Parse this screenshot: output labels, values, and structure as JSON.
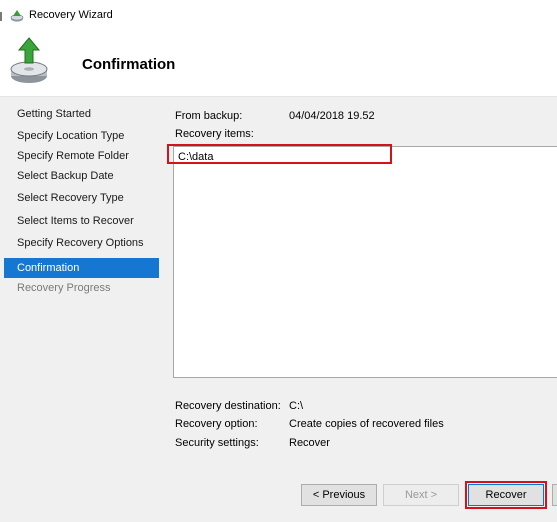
{
  "window": {
    "title": "Recovery Wizard",
    "icon": "wizard-app-icon"
  },
  "header": {
    "title": "Confirmation",
    "icon": "backup-disk-icon"
  },
  "sidebar": {
    "steps": [
      {
        "label": "Getting Started",
        "state": "done"
      },
      {
        "label": "Specify Location Type",
        "state": "done"
      },
      {
        "label": "Specify Remote Folder",
        "state": "done"
      },
      {
        "label": "Select Backup Date",
        "state": "done"
      },
      {
        "label": "Select Recovery Type",
        "state": "done"
      },
      {
        "label": "Select Items to Recover",
        "state": "done"
      },
      {
        "label": "Specify Recovery Options",
        "state": "done"
      },
      {
        "label": "Confirmation",
        "state": "active"
      },
      {
        "label": "Recovery Progress",
        "state": "disabled"
      }
    ]
  },
  "summary": {
    "from_backup_label": "From backup:",
    "from_backup_value": "04/04/2018 19.52",
    "recovery_items_label": "Recovery items:",
    "items": [
      "C:\\data"
    ],
    "destination_label": "Recovery destination:",
    "destination_value": "C:\\",
    "option_label": "Recovery option:",
    "option_value": "Create copies of recovered files",
    "security_label": "Security settings:",
    "security_value": "Recover"
  },
  "buttons": {
    "previous": "< Previous",
    "next": "Next >",
    "recover": "Recover"
  },
  "colors": {
    "active_step": "#1677d3",
    "highlight": "#d3121a",
    "panel_background": "#f0f0f0"
  }
}
